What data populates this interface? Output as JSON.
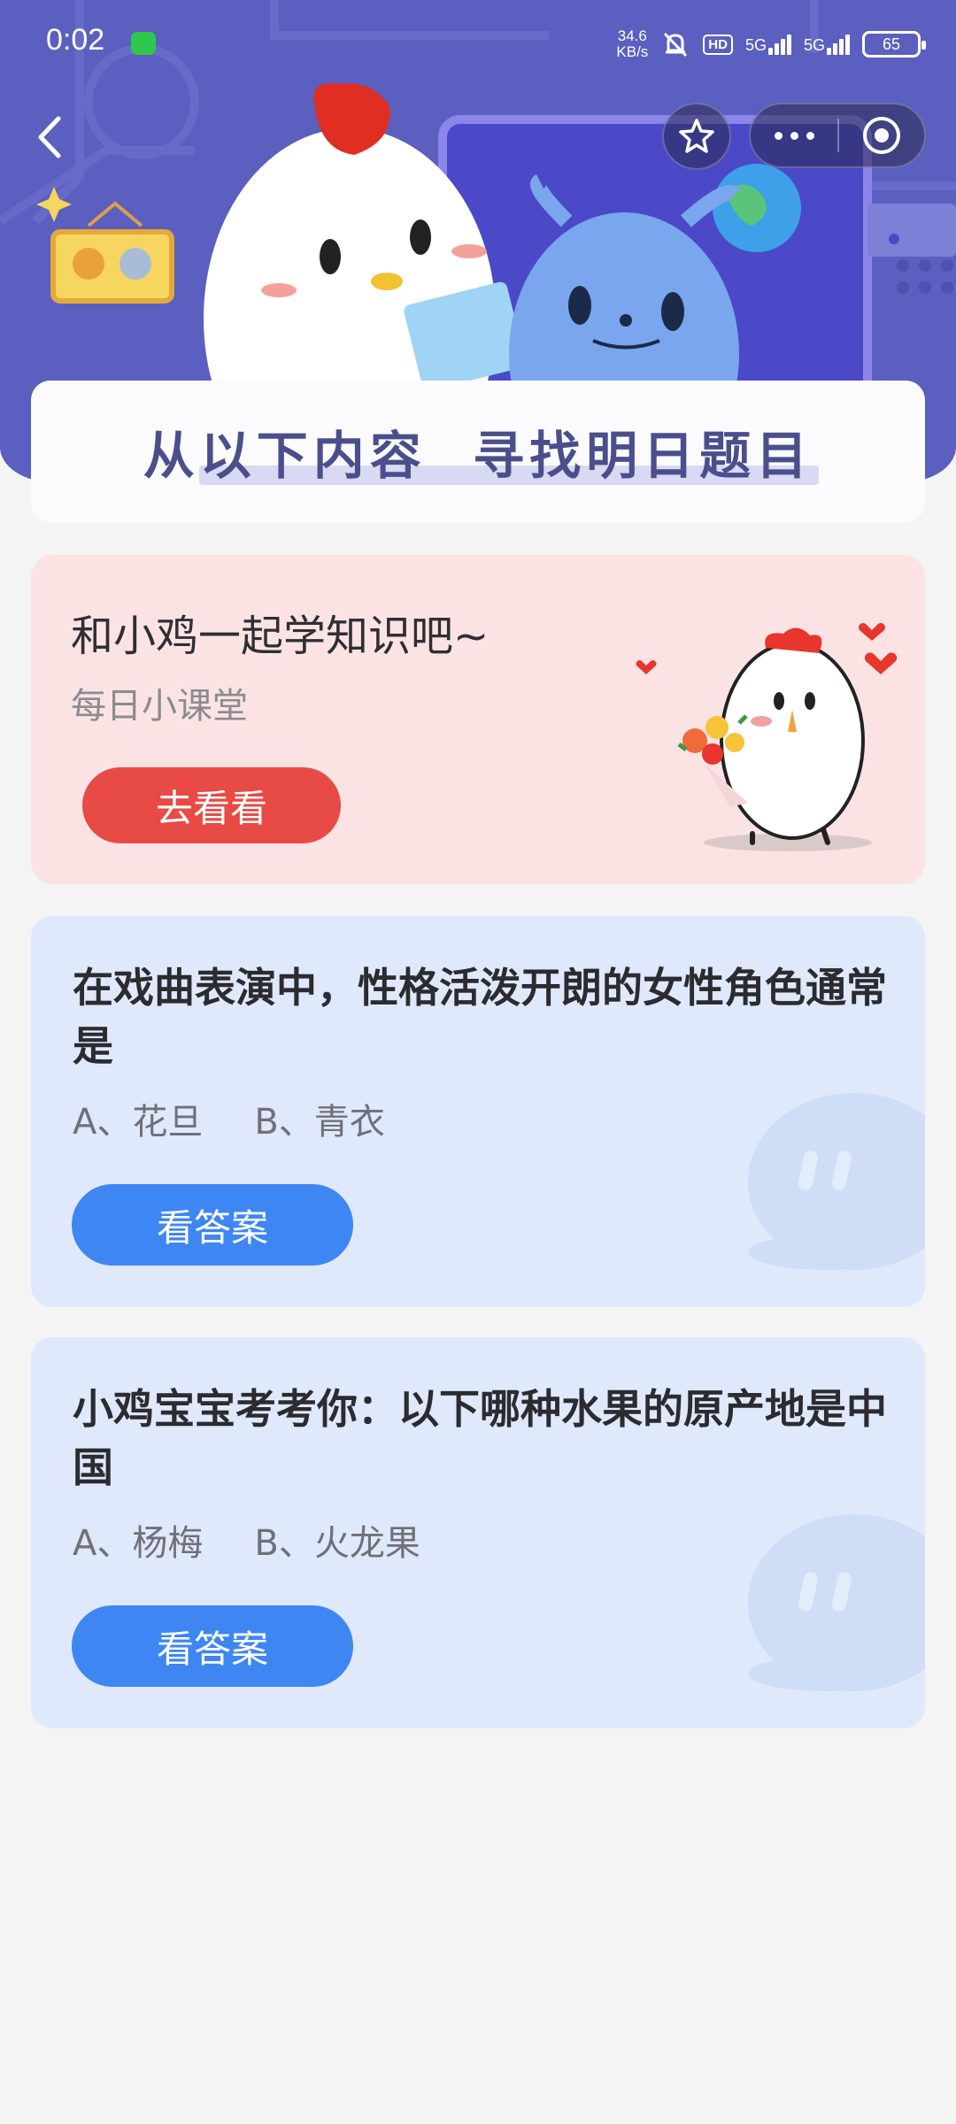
{
  "status_bar": {
    "time": "0:02",
    "net_speed_value": "34.6",
    "net_speed_unit": "KB/s",
    "hd_label": "HD",
    "sim1_label": "5G",
    "sim2_label": "5G",
    "battery": "65"
  },
  "header": {
    "banner_title": "从以下内容  寻找明日题目"
  },
  "lesson_card": {
    "title": "和小鸡一起学知识吧~",
    "subtitle": "每日小课堂",
    "button_label": "去看看"
  },
  "questions": [
    {
      "question": "在戏曲表演中，性格活泼开朗的女性角色通常是",
      "option_a": "A、花旦",
      "option_b": "B、青衣",
      "button_label": "看答案"
    },
    {
      "question": "小鸡宝宝考考你：以下哪种水果的原产地是中国",
      "option_a": "A、杨梅",
      "option_b": "B、火龙果",
      "button_label": "看答案"
    }
  ],
  "colors": {
    "banner_bg": "#5b5fbf",
    "lesson_card_bg": "#fbe3e4",
    "lesson_button": "#e84a45",
    "question_card_bg": "#dfe9fb",
    "question_button": "#3e86f2",
    "page_bg": "#f4f4f5"
  },
  "icons": [
    "back-icon",
    "star-icon",
    "more-icon",
    "close-target-icon",
    "wechat-icon",
    "mute-bell-icon",
    "signal-icon",
    "battery-icon"
  ]
}
